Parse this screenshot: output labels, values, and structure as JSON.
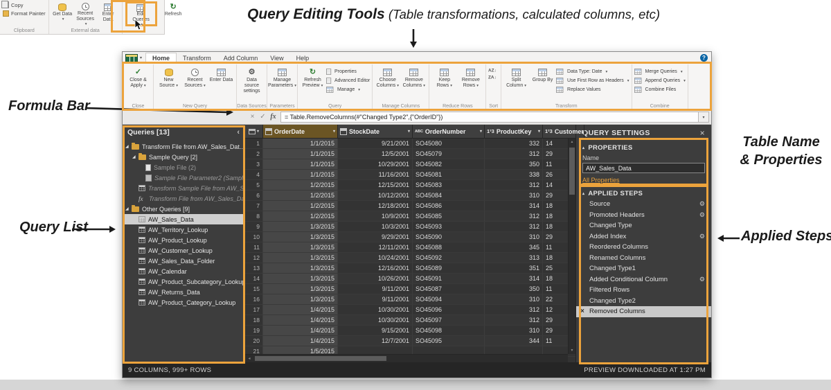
{
  "annotations": {
    "query_editing_tools_title": "Query Editing Tools",
    "query_editing_tools_subtitle": " (Table transformations, calculated columns,  etc)",
    "formula_bar": "Formula Bar",
    "query_list": "Query List",
    "table_name_line1": "Table Name",
    "table_name_line2": "& Properties",
    "applied_steps": "Applied Steps"
  },
  "icons": {
    "dropdown": "▾",
    "collapse": "‹",
    "close": "×",
    "check": "✓",
    "refresh": "↻",
    "gear": "⚙",
    "fx": "fx",
    "help": "?",
    "expanded": "◢",
    "section_tri": "▴",
    "sort_az": "AZ↓",
    "sort_za": "ZA↓",
    "abc": "ABC",
    "num123": "1²3",
    "up_arrow": "▲",
    "down_arrow": "▼",
    "left_arrow": "◂",
    "right_arrow": "▸"
  },
  "colors": {
    "highlight_box": "#ECA33C",
    "link": "#E9A13B",
    "selected_column_header": "#6B5524"
  },
  "desktop_ribbon": {
    "copy": "Copy",
    "format_painter": "Format Painter",
    "clipboard_group": "Clipboard",
    "get_data": "Get Data",
    "recent_sources": "Recent Sources",
    "enter_data": "Enter Data",
    "external_data_group": "External data",
    "edit_queries": "Edit Queries",
    "refresh": "Refresh"
  },
  "editor": {
    "tabs": [
      "Home",
      "Transform",
      "Add Column",
      "View",
      "Help"
    ],
    "active_tab": "Home",
    "help_label": "?",
    "ribbon_groups": [
      {
        "label": "Close",
        "big": [
          {
            "t": "Close & Apply",
            "dd": true,
            "ic": "close-apply"
          }
        ]
      },
      {
        "label": "New Query",
        "big": [
          {
            "t": "New Source",
            "dd": true,
            "ic": "new-source"
          },
          {
            "t": "Recent Sources",
            "dd": true,
            "ic": "recent-sources"
          },
          {
            "t": "Enter Data",
            "dd": false,
            "ic": "enter-data"
          }
        ]
      },
      {
        "label": "Data Sources",
        "big": [
          {
            "t": "Data source settings",
            "dd": false,
            "ic": "data-source-settings"
          }
        ]
      },
      {
        "label": "Parameters",
        "big": [
          {
            "t": "Manage Parameters",
            "dd": true,
            "ic": "manage-parameters"
          }
        ]
      },
      {
        "label": "Query",
        "big": [
          {
            "t": "Refresh Preview",
            "dd": true,
            "ic": "refresh-preview"
          }
        ],
        "small": [
          {
            "t": "Properties",
            "ic": "properties"
          },
          {
            "t": "Advanced Editor",
            "ic": "advanced-editor"
          },
          {
            "t": "Manage",
            "dd": true,
            "ic": "manage"
          }
        ]
      },
      {
        "label": "Manage Columns",
        "big": [
          {
            "t": "Choose Columns",
            "dd": true,
            "ic": "choose-columns"
          },
          {
            "t": "Remove Columns",
            "dd": true,
            "ic": "remove-columns"
          }
        ]
      },
      {
        "label": "Reduce Rows",
        "big": [
          {
            "t": "Keep Rows",
            "dd": true,
            "ic": "keep-rows"
          },
          {
            "t": "Remove Rows",
            "dd": true,
            "ic": "remove-rows"
          }
        ]
      },
      {
        "label": "Sort",
        "small": [
          {
            "t": "",
            "ic": "sort-az"
          },
          {
            "t": "",
            "ic": "sort-za"
          }
        ]
      },
      {
        "label": "Transform",
        "big": [
          {
            "t": "Split Column",
            "dd": true,
            "ic": "split-column"
          },
          {
            "t": "Group By",
            "dd": false,
            "ic": "group-by"
          }
        ],
        "small": [
          {
            "t": "Data Type: Date",
            "dd": true,
            "ic": "data-type"
          },
          {
            "t": "Use First Row as Headers",
            "dd": true,
            "ic": "first-row-headers"
          },
          {
            "t": "Replace Values",
            "ic": "replace-values"
          }
        ]
      },
      {
        "label": "Combine",
        "small": [
          {
            "t": "Merge Queries",
            "dd": true,
            "ic": "merge-queries"
          },
          {
            "t": "Append Queries",
            "dd": true,
            "ic": "append-queries"
          },
          {
            "t": "Combine Files",
            "ic": "combine-files"
          }
        ]
      }
    ],
    "formula": {
      "fx": "fx",
      "text": "= Table.RemoveColumns(#\"Changed Type2\",{\"OrderID\"})"
    },
    "queries": {
      "header": "Queries [13]",
      "items": [
        {
          "label": "Transform File from AW_Sales_Dat...",
          "icon": "folder",
          "indent": 0,
          "expander": true
        },
        {
          "label": "Sample Query [2]",
          "icon": "folder",
          "indent": 1,
          "expander": true
        },
        {
          "label": "Sample File (2)",
          "icon": "doc",
          "indent": 2,
          "dim": true
        },
        {
          "label": "Sample File Parameter2 (Sample...",
          "icon": "param",
          "indent": 2,
          "dim": true,
          "italic": true
        },
        {
          "label": "Transform Sample File from AW_S...",
          "icon": "table",
          "indent": 1,
          "dim": true,
          "italic": true
        },
        {
          "label": "Transform File from AW_Sales_Da...",
          "icon": "fx",
          "indent": 1,
          "dim": true,
          "italic": true
        },
        {
          "label": "Other Queries [9]",
          "icon": "folder",
          "indent": 0,
          "expander": true
        },
        {
          "label": "AW_Sales_Data",
          "icon": "table",
          "indent": 1,
          "selected": true
        },
        {
          "label": "AW_Territory_Lookup",
          "icon": "table",
          "indent": 1
        },
        {
          "label": "AW_Product_Lookup",
          "icon": "table",
          "indent": 1
        },
        {
          "label": "AW_Customer_Lookup",
          "icon": "table",
          "indent": 1
        },
        {
          "label": "AW_Sales_Data_Folder",
          "icon": "table",
          "indent": 1
        },
        {
          "label": "AW_Calendar",
          "icon": "table",
          "indent": 1
        },
        {
          "label": "AW_Product_Subcategory_Lookup",
          "icon": "table",
          "indent": 1
        },
        {
          "label": "AW_Returns_Data",
          "icon": "table",
          "indent": 1
        },
        {
          "label": "AW_Product_Category_Lookup",
          "icon": "table",
          "indent": 1
        }
      ]
    },
    "grid": {
      "columns": [
        {
          "name": "OrderDate",
          "type": "date",
          "selected": true
        },
        {
          "name": "StockDate",
          "type": "date"
        },
        {
          "name": "OrderNumber",
          "type": "text"
        },
        {
          "name": "ProductKey",
          "type": "number"
        },
        {
          "name": "CustomerKey",
          "type": "number"
        }
      ],
      "rows": [
        [
          "1/1/2015",
          "9/21/2001",
          "SO45080",
          "332",
          "14"
        ],
        [
          "1/1/2015",
          "12/5/2001",
          "SO45079",
          "312",
          "29"
        ],
        [
          "1/1/2015",
          "10/29/2001",
          "SO45082",
          "350",
          "11"
        ],
        [
          "1/1/2015",
          "11/16/2001",
          "SO45081",
          "338",
          "26"
        ],
        [
          "1/2/2015",
          "12/15/2001",
          "SO45083",
          "312",
          "14"
        ],
        [
          "1/2/2015",
          "10/12/2001",
          "SO45084",
          "310",
          "29"
        ],
        [
          "1/2/2015",
          "12/18/2001",
          "SO45086",
          "314",
          "18"
        ],
        [
          "1/2/2015",
          "10/9/2001",
          "SO45085",
          "312",
          "18"
        ],
        [
          "1/3/2015",
          "10/3/2001",
          "SO45093",
          "312",
          "18"
        ],
        [
          "1/3/2015",
          "9/29/2001",
          "SO45090",
          "310",
          "29"
        ],
        [
          "1/3/2015",
          "12/11/2001",
          "SO45088",
          "345",
          "11"
        ],
        [
          "1/3/2015",
          "10/24/2001",
          "SO45092",
          "313",
          "18"
        ],
        [
          "1/3/2015",
          "12/16/2001",
          "SO45089",
          "351",
          "25"
        ],
        [
          "1/3/2015",
          "10/26/2001",
          "SO45091",
          "314",
          "18"
        ],
        [
          "1/3/2015",
          "9/11/2001",
          "SO45087",
          "350",
          "11"
        ],
        [
          "1/3/2015",
          "9/11/2001",
          "SO45094",
          "310",
          "22"
        ],
        [
          "1/4/2015",
          "10/30/2001",
          "SO45096",
          "312",
          "12"
        ],
        [
          "1/4/2015",
          "10/30/2001",
          "SO45097",
          "312",
          "29"
        ],
        [
          "1/4/2015",
          "9/15/2001",
          "SO45098",
          "310",
          "29"
        ],
        [
          "1/4/2015",
          "12/7/2001",
          "SO45095",
          "344",
          "11"
        ],
        [
          "1/5/2015",
          "",
          "",
          "",
          ""
        ]
      ]
    },
    "query_settings": {
      "title": "QUERY SETTINGS",
      "properties_header": "PROPERTIES",
      "name_label": "Name",
      "name_value": "AW_Sales_Data",
      "all_properties": "All Properties",
      "applied_steps_header": "APPLIED STEPS",
      "steps": [
        {
          "label": "Source",
          "gear": true
        },
        {
          "label": "Promoted Headers",
          "gear": true
        },
        {
          "label": "Changed Type"
        },
        {
          "label": "Added Index",
          "gear": true
        },
        {
          "label": "Reordered Columns"
        },
        {
          "label": "Renamed Columns"
        },
        {
          "label": "Changed Type1"
        },
        {
          "label": "Added Conditional Column",
          "gear": true
        },
        {
          "label": "Filtered Rows"
        },
        {
          "label": "Changed Type2"
        },
        {
          "label": "Removed Columns",
          "selected": true,
          "delete": true
        }
      ]
    },
    "status": {
      "left": "9 COLUMNS, 999+ ROWS",
      "right": "PREVIEW DOWNLOADED AT 1:27 PM"
    }
  }
}
